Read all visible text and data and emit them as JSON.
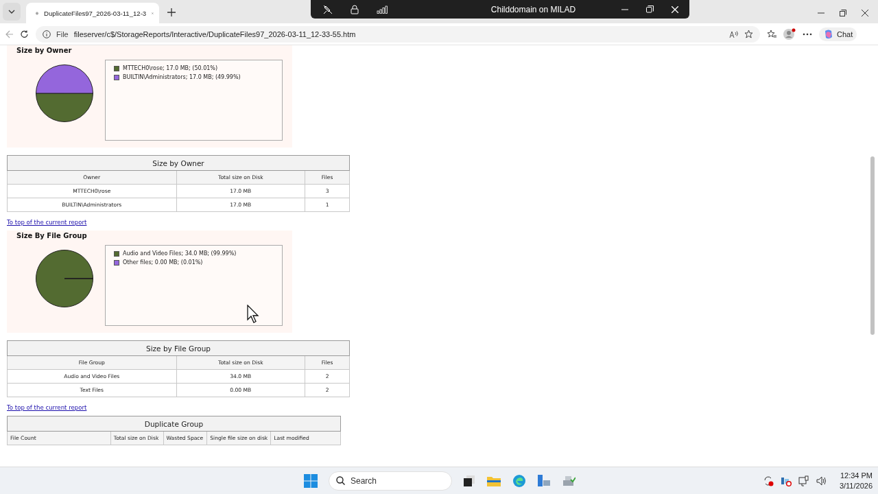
{
  "browser": {
    "tab_title": "DuplicateFiles97_2026-03-11_12-3",
    "address_prefix": "File",
    "url": "fileserver/c$/StorageReports/Interactive/DuplicateFiles97_2026-03-11_12-33-55.htm",
    "chat_label": "Chat"
  },
  "remote_bar": {
    "title": "Childdomain on MILAD"
  },
  "report": {
    "sections": [
      {
        "kind": "chart",
        "heading": "Size by Owner",
        "legend": [
          {
            "text": "MTTECH0\\rose; 17.0 MB; (50.01%)",
            "color": "#536b31"
          },
          {
            "text": "BUILTIN\\Administrators; 17.0 MB; (49.99%)",
            "color": "#9466dc"
          }
        ],
        "chart_data": {
          "type": "pie",
          "values": [
            50.01,
            49.99
          ]
        }
      },
      {
        "kind": "table",
        "title": "Size by Owner",
        "columns": [
          "Owner",
          "Total size on Disk",
          "Files"
        ],
        "rows": [
          [
            "MTTECH0\\rose",
            "17.0 MB",
            "3"
          ],
          [
            "BUILTIN\\Administrators",
            "17.0 MB",
            "1"
          ]
        ]
      },
      {
        "kind": "link",
        "text": "To top of the current report"
      },
      {
        "kind": "chart",
        "heading": "Size By File Group",
        "legend": [
          {
            "text": "Audio and Video Files; 34.0 MB; (99.99%)",
            "color": "#536b31"
          },
          {
            "text": "Other files; 0.00 MB; (0.01%)",
            "color": "#9466dc"
          }
        ],
        "chart_data": {
          "type": "pie",
          "values": [
            99.99,
            0.01
          ]
        }
      },
      {
        "kind": "table",
        "title": "Size by File Group",
        "columns": [
          "File Group",
          "Total size on Disk",
          "Files"
        ],
        "rows": [
          [
            "Audio and Video Files",
            "34.0 MB",
            "2"
          ],
          [
            "Text Files",
            "0.00 MB",
            "2"
          ]
        ]
      },
      {
        "kind": "link",
        "text": "To top of the current report"
      },
      {
        "kind": "table",
        "title": "Duplicate Group",
        "columns": [
          "File Count",
          "Total size on Disk",
          "Wasted Space",
          "Single file size on disk",
          "Last modified"
        ]
      }
    ]
  },
  "taskbar": {
    "search_placeholder": "Search",
    "time": "12:34 PM",
    "date": "3/11/2026"
  }
}
